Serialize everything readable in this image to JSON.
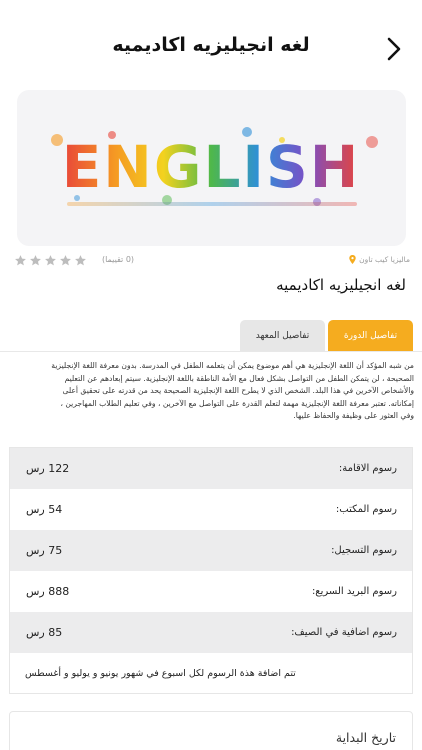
{
  "header": {
    "title": "لغه انجيليزيه اكاديميه"
  },
  "banner": {
    "word": "ENGLISH"
  },
  "meta": {
    "rating_value": 0,
    "rating_max": 5,
    "rating_text": "(0 تقييما)",
    "location": "ماليزيا  كيب تاون"
  },
  "title": "لغه انجيليزيه اكاديميه",
  "tabs": [
    {
      "label": "تفاصيل الدورة",
      "active": true
    },
    {
      "label": "تفاصيل المعهد",
      "active": false
    }
  ],
  "description": {
    "lines": [
      "من شبه المؤكد أن اللغة الإنجليزية هي أهم موضوع يمكن أن يتعلمه الطفل في المدرسة. بدون معرفة اللغة الإنجليزية",
      "الصحيحة ، لن يتمكن الطفل من التواصل بشكل فعال مع الأمة الناطقة باللغة الإنجليزية. سيتم إبعادهم عن التعليم",
      "والأشخاص الآخرين في هذا البلد. الشخص الذي لا يطرح اللغة الإنجليزية الصحيحة يحد من قدرته على تحقيق أعلى",
      "إمكاناته. تعتبر معرفة اللغة الإنجليزية مهمة لتعلم القدرة على التواصل مع الآخرين ، وفي تعليم الطلاب المهاجرين ،",
      "وفي العثور على وظيفة والحفاظ عليها."
    ]
  },
  "fees": {
    "rows": [
      {
        "label": "رسوم الاقامة:",
        "value": "122 رس"
      },
      {
        "label": "رسوم المكتب:",
        "value": "54 رس"
      },
      {
        "label": "رسوم التسجيل:",
        "value": "75 رس"
      },
      {
        "label": "رسوم البريد السريع:",
        "value": "888 رس"
      },
      {
        "label": "رسوم اضافية في الصيف:",
        "value": "85 رس"
      }
    ],
    "note": "تتم اضافة هذة الرسوم لكل اسبوع في شهور يونيو و يوليو و أغسطس"
  },
  "start": {
    "title": "تاريخ البداية"
  },
  "colors": {
    "accent": "#f5ac1f",
    "star": "#bdbdbd",
    "pin": "#f5ac1f"
  }
}
